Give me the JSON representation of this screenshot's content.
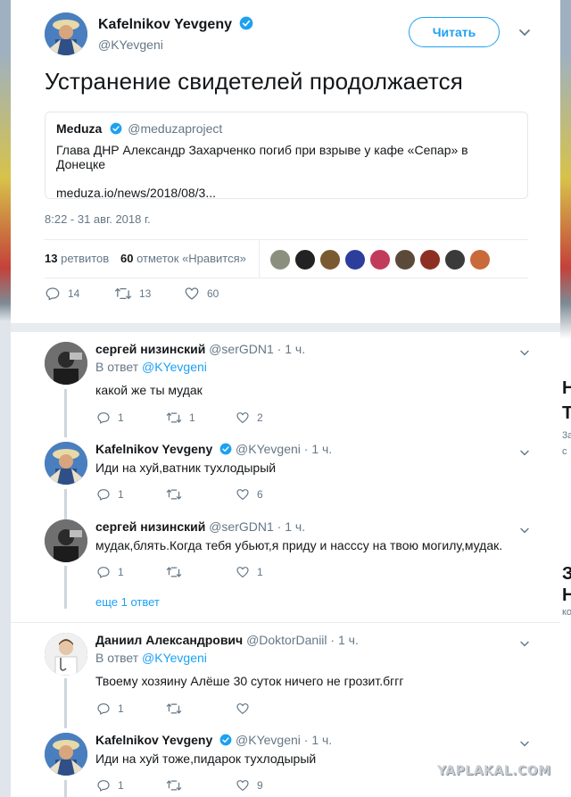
{
  "main_tweet": {
    "author_name": "Kafelnikov Yevgeny",
    "author_handle": "@KYevgeni",
    "follow_label": "Читать",
    "text": "Устранение свидетелей продолжается",
    "quote": {
      "name": "Meduza",
      "handle": "@meduzaproject",
      "text": "Глава ДНР Александр Захарченко погиб при взрыве у кафе «Сепар» в Донецке",
      "link": "meduza.io/news/2018/08/3..."
    },
    "timestamp": "8:22 - 31 авг. 2018 г.",
    "retweets_count": "13",
    "retweets_label": "ретвитов",
    "likes_count": "60",
    "likes_label": "отметок «Нравится»",
    "actions": {
      "replies": "14",
      "retweets": "13",
      "likes": "60"
    }
  },
  "replies": [
    {
      "name": "сергей низинский",
      "handle": "@serGDN1",
      "time": "· 1 ч.",
      "reply_to_label": "В ответ",
      "reply_to": "@KYevgeni",
      "text": "какой же ты мудак",
      "replies": "1",
      "retweets": "1",
      "likes": "2"
    },
    {
      "name": "Kafelnikov Yevgeny",
      "handle": "@KYevgeni",
      "time": "· 1 ч.",
      "text": "Иди на хуй,ватник тухлодырый",
      "replies": "1",
      "retweets": "",
      "likes": "6"
    },
    {
      "name": "сергей низинский",
      "handle": "@serGDN1",
      "time": "· 1 ч.",
      "text": "мудак,блять.Когда тебя убьют,я приду и насссу на твою могилу,мудак.",
      "replies": "1",
      "retweets": "",
      "likes": "1"
    },
    {
      "more_link": "еще 1 ответ"
    },
    {
      "name": "Даниил Александрович",
      "handle": "@DoktorDaniil",
      "time": "· 1 ч.",
      "reply_to_label": "В ответ",
      "reply_to": "@KYevgeni",
      "text": "Твоему хозяину Алёше 30 суток ничего не грозит.бггг",
      "replies": "1",
      "retweets": "",
      "likes": ""
    },
    {
      "name": "Kafelnikov Yevgeny",
      "handle": "@KYevgeni",
      "time": "· 1 ч.",
      "text": "Иди на хуй тоже,пидарок тухлодырый",
      "replies": "1",
      "retweets": "",
      "likes": "9"
    }
  ],
  "background_right": {
    "letter1": "Н",
    "letter2": "Т",
    "small1": "3a",
    "small2": "с",
    "letter3": "За",
    "letter4": "Н",
    "small3": "ко"
  },
  "watermark": "YAPLAKAL.COM",
  "colors": {
    "accent": "#1da1f2",
    "secondary_text": "#657786",
    "verified": "#1da1f2",
    "divider": "#e6ecf0"
  },
  "icons": [
    "verified-badge-icon",
    "chevron-down-icon",
    "reply-icon",
    "retweet-icon",
    "heart-icon"
  ]
}
